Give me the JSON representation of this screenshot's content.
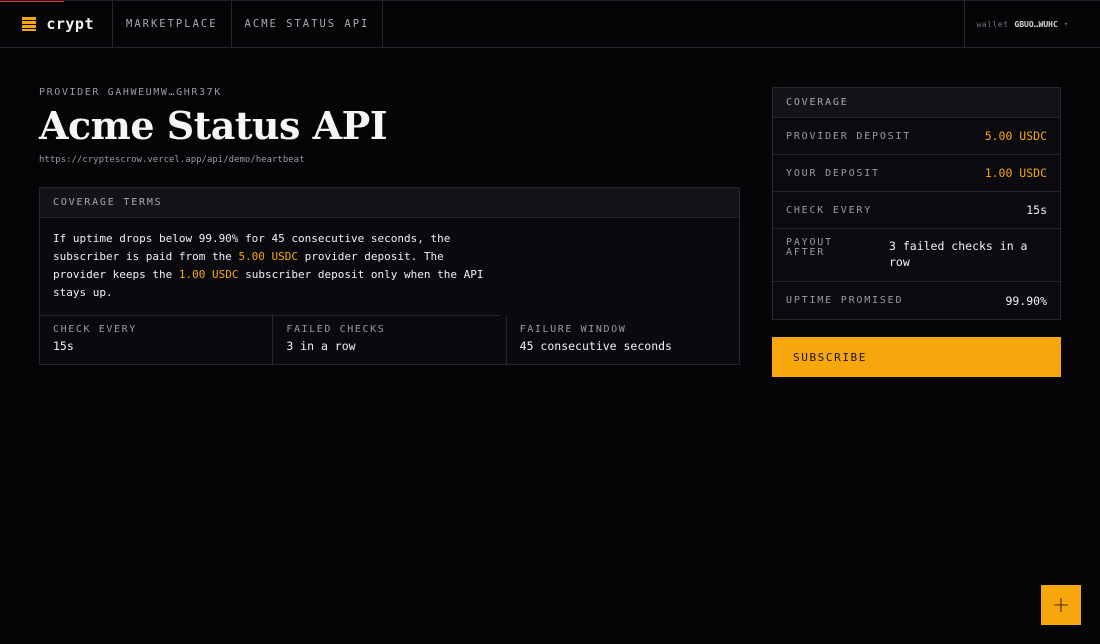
{
  "brand": {
    "name": "crypt",
    "icon": "stacked-bars-logo-icon"
  },
  "nav": {
    "items": [
      "MARKETPLACE",
      "ACME STATUS API"
    ]
  },
  "wallet": {
    "label": "wallet",
    "address": "GBUO…WUHC",
    "caret": "▾"
  },
  "provider": {
    "label": "PROVIDER GAHWEUMW…GHR37K"
  },
  "api": {
    "title": "Acme Status API",
    "endpoint": "https://cryptescrow.vercel.app/api/demo/heartbeat"
  },
  "terms": {
    "heading": "COVERAGE TERMS",
    "description": {
      "part1": "If uptime drops below 99.90% for 45 consecutive seconds, the subscriber is paid from the ",
      "provider_deposit": "5.00 USDC",
      "part2": " provider deposit. The provider keeps the ",
      "subscriber_deposit": "1.00 USDC",
      "part3": " subscriber deposit only when the API stays up."
    },
    "stats": [
      {
        "label": "CHECK EVERY",
        "value": "15s"
      },
      {
        "label": "FAILED CHECKS",
        "value": "3 in a row"
      },
      {
        "label": "FAILURE WINDOW",
        "value": "45 consecutive seconds"
      }
    ]
  },
  "coverage": {
    "heading": "COVERAGE",
    "rows": [
      {
        "label": "PROVIDER DEPOSIT",
        "value": "5.00 USDC"
      },
      {
        "label": "YOUR DEPOSIT",
        "value": "1.00 USDC"
      },
      {
        "label": "CHECK EVERY",
        "value": "15s"
      },
      {
        "label": "PAYOUT AFTER",
        "value": "3 failed checks in a row"
      },
      {
        "label": "UPTIME PROMISED",
        "value": "99.90%"
      }
    ]
  },
  "subscribe": {
    "label": "SUBSCRIBE"
  },
  "fab": {
    "label": "+",
    "icon": "plus-icon"
  },
  "colors": {
    "accent": "#f5a70c",
    "background": "#050508",
    "border": "#26262c"
  }
}
